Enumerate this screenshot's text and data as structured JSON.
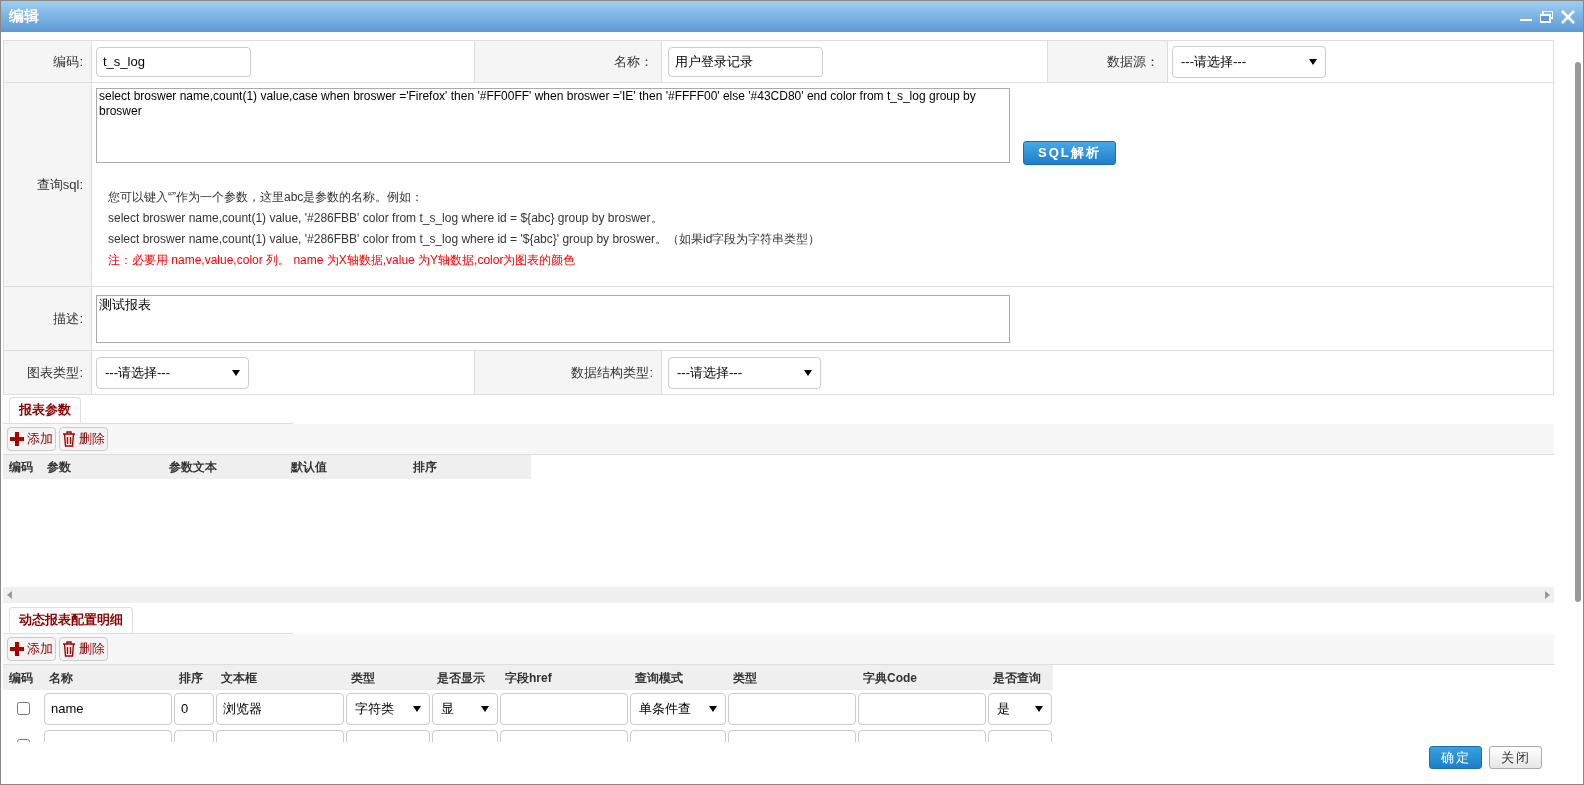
{
  "window": {
    "title": "编辑"
  },
  "form": {
    "code": {
      "label": "编码:",
      "value": "t_s_log"
    },
    "name": {
      "label": "名称：",
      "value": "用户登录记录"
    },
    "datasource": {
      "label": "数据源：",
      "value": "---请选择---"
    },
    "sql": {
      "label": "查询sql:",
      "value": "select broswer name,count(1) value,case when broswer ='Firefox' then '#FF00FF' when broswer ='IE' then '#FFFF00' else '#43CD80' end color from t_s_log group by broswer",
      "button": "SQL解析",
      "hints": [
        "您可以键入“”作为一个参数，这里abc是参数的名称。例如：",
        "select broswer name,count(1) value, '#286FBB' color from t_s_log where id = ${abc} group by broswer。",
        "select broswer name,count(1) value, '#286FBB' color from t_s_log where id = '${abc}' group by broswer。（如果id字段为字符串类型）"
      ],
      "warning": "注：必要用 name,value,color 列。 name 为X轴数据,value 为Y轴数据,color为图表的颜色"
    },
    "description": {
      "label": "描述:",
      "value": "测试报表"
    },
    "chart_type": {
      "label": "图表类型:",
      "value": "---请选择---"
    },
    "data_structure_type": {
      "label": "数据结构类型:",
      "value": "---请选择---"
    }
  },
  "params_panel": {
    "tabs": [
      {
        "label": "报表参数",
        "selected": true
      }
    ],
    "toolbar": [
      {
        "kind": "add",
        "label": "添加"
      },
      {
        "kind": "delete",
        "label": "删除"
      }
    ],
    "columns": [
      "编码",
      "参数",
      "参数文本",
      "默认值",
      "排序"
    ]
  },
  "detail_panel": {
    "tabs": [
      {
        "label": "动态报表配置明细",
        "selected": true
      }
    ],
    "toolbar": [
      {
        "kind": "add",
        "label": "添加"
      },
      {
        "kind": "delete",
        "label": "删除"
      }
    ],
    "columns": [
      "编码",
      "名称",
      "排序",
      "文本框",
      "类型",
      "是否显示",
      "字段href",
      "查询模式",
      "类型",
      "字典Code",
      "是否查询"
    ],
    "rows": [
      {
        "cells": [
          {
            "kind": "checkbox",
            "checked": false
          },
          {
            "kind": "input",
            "value": "name"
          },
          {
            "kind": "input",
            "value": "0"
          },
          {
            "kind": "input",
            "value": "浏览器"
          },
          {
            "kind": "select",
            "value": "字符类"
          },
          {
            "kind": "select",
            "value": "显"
          },
          {
            "kind": "input"
          },
          {
            "kind": "select",
            "value": "单条件查"
          },
          {
            "kind": "input"
          },
          {
            "kind": "input"
          },
          {
            "kind": "select",
            "value": "是"
          }
        ]
      },
      {
        "cells": [
          {
            "kind": "checkbox",
            "checked": false
          },
          {
            "kind": "input"
          },
          {
            "kind": "input"
          },
          {
            "kind": "input"
          },
          {
            "kind": "select"
          },
          {
            "kind": "select"
          },
          {
            "kind": "input"
          },
          {
            "kind": "select"
          },
          {
            "kind": "input"
          },
          {
            "kind": "input"
          },
          {
            "kind": "select"
          }
        ]
      }
    ]
  },
  "footer": {
    "buttons": [
      {
        "kind": "primary",
        "label": "确定"
      },
      {
        "kind": "default",
        "label": "关闭"
      }
    ]
  }
}
